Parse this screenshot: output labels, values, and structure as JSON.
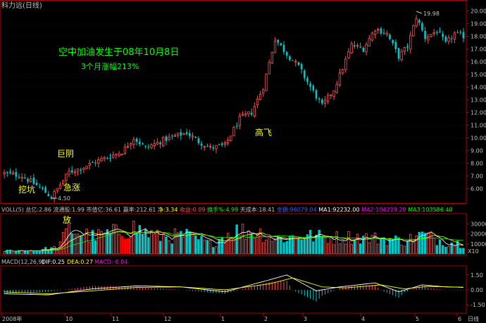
{
  "window_title": "科力远(日线)",
  "colors": {
    "background": "#000000",
    "frame": "#b00000",
    "grid": "#800000",
    "up": "#ff5050",
    "down": "#00c8c8",
    "text": "#c0c0c0",
    "annotation": "#ffff00",
    "ma1": "#ffffff",
    "ma2": "#ffff00",
    "ma3": "#00ff00",
    "highlight_bar": "#ff0000"
  },
  "annotations": {
    "title_line1": "空中加油发生于08年10月8日",
    "title_line2": "3个月涨幅213%",
    "wa_keng": "挖坑",
    "ji_zhang": "急涨",
    "ju_yin": "巨阴",
    "gao_fei": "高飞",
    "fang": "放"
  },
  "volume_panel": {
    "label": "VOLL(5)",
    "fields": [
      {
        "text": "总亿:2.86",
        "color": "#c0c0c0"
      },
      {
        "text": "流通股:1.99",
        "color": "#c0c0c0"
      },
      {
        "text": "市值亿:36.61",
        "color": "#c0c0c0"
      },
      {
        "text": "赢率:212.61",
        "color": "#c0c0c0"
      },
      {
        "text": "净:3.34",
        "color": "#ffff00"
      },
      {
        "text": "收益:0.09",
        "color": "#ff5050"
      },
      {
        "text": "换手%:4.99",
        "color": "#00ff00"
      },
      {
        "text": "天成本:18.41",
        "color": "#c0c0c0"
      },
      {
        "text": "金額:96079.04",
        "color": "#3060ff"
      },
      {
        "text": "MA1:92232.00",
        "color": "#ffffff"
      },
      {
        "text": "MA2:104219.20",
        "color": "#ff00ff"
      },
      {
        "text": "MA3:103586.40",
        "color": "#00ff00"
      }
    ],
    "unit_label": "X10"
  },
  "macd_panel": {
    "label": "MACD(12,26,9)",
    "dif": "DIF:0.25",
    "dea": "DEA:0.27",
    "macd": "MACD:-0.04"
  },
  "x_axis_labels": [
    "2008年",
    "10",
    "11",
    "12",
    "1",
    "2",
    "3",
    "4",
    "5",
    "6",
    "日线"
  ],
  "chart_data": [
    {
      "type": "candlestick",
      "title": "科力远(日线)",
      "y_ticks": [
        "20.00",
        "19.00",
        "18.00",
        "17.00",
        "16.00",
        "15.00",
        "14.00",
        "13.00",
        "12.00",
        "11.00",
        "10.00",
        "9.00",
        "8.00",
        "7.00",
        "6.00"
      ],
      "ylim": [
        5.3,
        20.3
      ],
      "low_marker": "4.50",
      "high_marker": "19.98",
      "close_path": [
        {
          "bar": 0,
          "price": 7.2
        },
        {
          "bar": 6,
          "price": 7.0
        },
        {
          "bar": 12,
          "price": 6.1
        },
        {
          "bar": 16,
          "price": 5.3
        },
        {
          "bar": 19,
          "price": 6.3
        },
        {
          "bar": 22,
          "price": 7.3
        },
        {
          "bar": 26,
          "price": 7.6
        },
        {
          "bar": 32,
          "price": 8.2
        },
        {
          "bar": 40,
          "price": 8.9
        },
        {
          "bar": 44,
          "price": 10.0
        },
        {
          "bar": 48,
          "price": 9.2
        },
        {
          "bar": 55,
          "price": 9.9
        },
        {
          "bar": 62,
          "price": 10.4
        },
        {
          "bar": 66,
          "price": 9.7
        },
        {
          "bar": 70,
          "price": 9.2
        },
        {
          "bar": 75,
          "price": 9.4
        },
        {
          "bar": 80,
          "price": 11.5
        },
        {
          "bar": 84,
          "price": 12.0
        },
        {
          "bar": 88,
          "price": 14.0
        },
        {
          "bar": 92,
          "price": 17.8
        },
        {
          "bar": 96,
          "price": 16.6
        },
        {
          "bar": 100,
          "price": 15.6
        },
        {
          "bar": 104,
          "price": 14.0
        },
        {
          "bar": 108,
          "price": 12.5
        },
        {
          "bar": 112,
          "price": 13.8
        },
        {
          "bar": 115,
          "price": 15.5
        },
        {
          "bar": 118,
          "price": 17.3
        },
        {
          "bar": 122,
          "price": 17.0
        },
        {
          "bar": 126,
          "price": 18.6
        },
        {
          "bar": 130,
          "price": 18.2
        },
        {
          "bar": 134,
          "price": 16.4
        },
        {
          "bar": 137,
          "price": 17.2
        },
        {
          "bar": 140,
          "price": 19.5
        },
        {
          "bar": 143,
          "price": 17.9
        },
        {
          "bar": 147,
          "price": 18.4
        },
        {
          "bar": 150,
          "price": 17.4
        },
        {
          "bar": 153,
          "price": 18.2
        },
        {
          "bar": 156,
          "price": 18.0
        }
      ]
    },
    {
      "type": "bar",
      "title": "VOLL(5)",
      "y_ticks": [
        "30000",
        "20000",
        "10000"
      ],
      "ylim": [
        0,
        38000
      ],
      "volume_path": [
        {
          "bar": 0,
          "value": 3000
        },
        {
          "bar": 10,
          "value": 3500
        },
        {
          "bar": 18,
          "value": 6000
        },
        {
          "bar": 22,
          "value": 25000
        },
        {
          "bar": 30,
          "value": 17000
        },
        {
          "bar": 36,
          "value": 20000
        },
        {
          "bar": 44,
          "value": 26000
        },
        {
          "bar": 52,
          "value": 17000
        },
        {
          "bar": 62,
          "value": 18000
        },
        {
          "bar": 70,
          "value": 10000
        },
        {
          "bar": 78,
          "value": 23000
        },
        {
          "bar": 86,
          "value": 22000
        },
        {
          "bar": 92,
          "value": 15000
        },
        {
          "bar": 102,
          "value": 18000
        },
        {
          "bar": 112,
          "value": 16000
        },
        {
          "bar": 120,
          "value": 17000
        },
        {
          "bar": 128,
          "value": 15000
        },
        {
          "bar": 136,
          "value": 13000
        },
        {
          "bar": 142,
          "value": 19000
        },
        {
          "bar": 150,
          "value": 12000
        },
        {
          "bar": 156,
          "value": 10000
        }
      ]
    },
    {
      "type": "bar",
      "title": "MACD(12,26,9)",
      "y_ticks": [
        "1.50",
        "0.00",
        "-1.50"
      ],
      "ylim": [
        -2.2,
        2.2
      ],
      "dif_path": [
        {
          "bar": 0,
          "value": -0.4
        },
        {
          "bar": 15,
          "value": -0.5
        },
        {
          "bar": 30,
          "value": 0.1
        },
        {
          "bar": 45,
          "value": 0.4
        },
        {
          "bar": 60,
          "value": 0.3
        },
        {
          "bar": 75,
          "value": -0.2
        },
        {
          "bar": 90,
          "value": 1.0
        },
        {
          "bar": 96,
          "value": 1.5
        },
        {
          "bar": 106,
          "value": -0.1
        },
        {
          "bar": 114,
          "value": 0.3
        },
        {
          "bar": 126,
          "value": 0.7
        },
        {
          "bar": 134,
          "value": -0.2
        },
        {
          "bar": 142,
          "value": 0.5
        },
        {
          "bar": 150,
          "value": 0.3
        },
        {
          "bar": 156,
          "value": 0.25
        }
      ],
      "dea_path": [
        {
          "bar": 0,
          "value": -0.2
        },
        {
          "bar": 15,
          "value": -0.4
        },
        {
          "bar": 30,
          "value": -0.1
        },
        {
          "bar": 45,
          "value": 0.25
        },
        {
          "bar": 60,
          "value": 0.3
        },
        {
          "bar": 75,
          "value": 0.0
        },
        {
          "bar": 90,
          "value": 0.6
        },
        {
          "bar": 98,
          "value": 1.2
        },
        {
          "bar": 108,
          "value": 0.3
        },
        {
          "bar": 116,
          "value": 0.2
        },
        {
          "bar": 128,
          "value": 0.5
        },
        {
          "bar": 136,
          "value": 0.1
        },
        {
          "bar": 144,
          "value": 0.35
        },
        {
          "bar": 156,
          "value": 0.27
        }
      ]
    }
  ]
}
